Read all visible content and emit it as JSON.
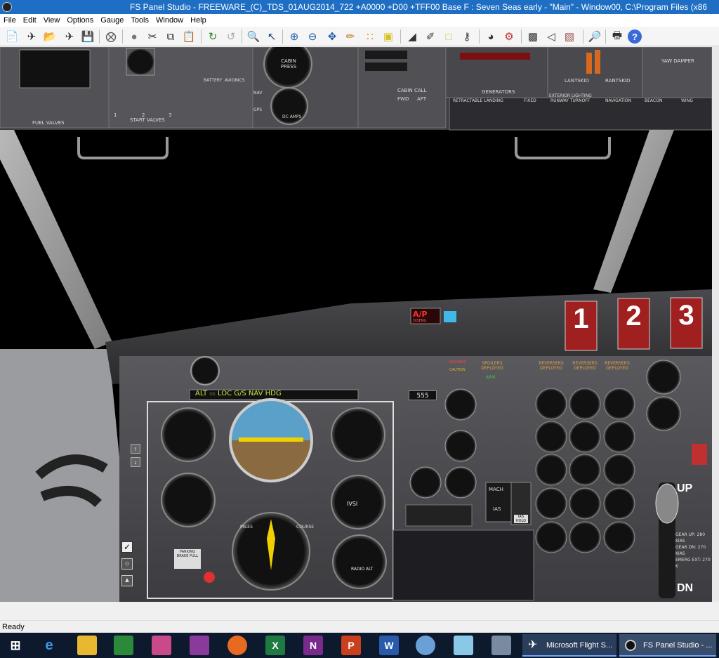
{
  "window": {
    "title": "FS Panel Studio - FREEWARE_(C)_TDS_01AUG2014_722 +A0000 +D00 +TFF00 Base F : Seven Seas early - \"Main\" - Window00, C:\\Program Files (x86"
  },
  "menu": [
    "File",
    "Edit",
    "View",
    "Options",
    "Gauge",
    "Tools",
    "Window",
    "Help"
  ],
  "toolbar_icons": [
    "new-icon",
    "plane-icon",
    "open-folder-icon",
    "plane-save-icon",
    "save-icon",
    "close-circle-icon",
    "sphere-icon",
    "cut-icon",
    "copy-icon",
    "paste-icon",
    "magnifier-icon",
    "pointer-icon",
    "zoom-in-icon",
    "zoom-out-icon",
    "move-icon",
    "brush-icon",
    "grid-icon",
    "layer-icon",
    "triangle-icon",
    "tool-icon",
    "rectangle-icon",
    "headset-icon",
    "gauge-icon",
    "settings-icon",
    "window-icon",
    "speaker-icon",
    "color-icon",
    "preview-icon",
    "print-icon",
    "help-icon"
  ],
  "overhead": {
    "fuel_valves": "FUEL VALVES",
    "start_valves": "START VALVES",
    "start_valve_numbers": [
      "1",
      "2",
      "3"
    ],
    "cabin_press": "CABIN PRESS",
    "battery": "BATTERY",
    "avionics": "AVIONICS",
    "dc_amps": "DC AMPS",
    "gps": "GPS",
    "nav": "NAV",
    "cabin_call": "CABIN CALL",
    "fwd": "FWD",
    "aft": "AFT",
    "generators": "GENERATORS",
    "lantskid": "LANTSKID",
    "rantskid": "RANTSKID",
    "yaw_damper": "YAW DAMPER",
    "exterior_lighting": "EXTERIOR LIGHTING",
    "retractable_landing": "RETRACTABLE LANDING",
    "fixed": "FIXED",
    "runway_turnoff": "RUNWAY TURNOFF",
    "navigation": "NAVIGATION",
    "beacon": "BEACON",
    "wing": "WING"
  },
  "glareshield": {
    "ap_label": "A/P",
    "ap_sub": "DISENG",
    "engine_numbers": [
      "1",
      "2",
      "3"
    ],
    "reversers": [
      "REVERSERS DEPLOYED",
      "REVERSERS DEPLOYED",
      "REVERSERS DEPLOYED"
    ],
    "spoilers": "SPOILERS DEPLOYED",
    "warning": "WARNING",
    "caution": "CAUTION",
    "arm": "ARM"
  },
  "annunciator": [
    "ALT",
    "GS",
    "LOC",
    "G/S",
    "NAV",
    "HDG"
  ],
  "instruments": {
    "mach": "MACH",
    "ias": "IAS",
    "ias_hold": "IAS HOLD",
    "ivsi": "IVSI",
    "radio_alt": "RADIO ALT",
    "course": "COURSE",
    "miles": "MILES",
    "parking_brake": "PARKING BRAKE PULL",
    "up": "UP",
    "dn": "DN",
    "gear_info": [
      "GEAR UP: 280 KIAS",
      "GEAR DN: 270 KIAS",
      "EMERG EXT: 270 K"
    ],
    "counter": "555"
  },
  "status": "Ready",
  "taskbar": {
    "apps": [
      "start-icon",
      "edge-icon",
      "folder-icon",
      "store-icon",
      "photos-icon",
      "connect-icon",
      "firefox-icon",
      "excel-icon",
      "onenote-icon",
      "powerpoint-icon",
      "word-icon",
      "paint-icon",
      "sketch-icon",
      "calculator-icon"
    ],
    "windows": [
      "Microsoft Flight S...",
      "FS Panel Studio - ..."
    ]
  }
}
